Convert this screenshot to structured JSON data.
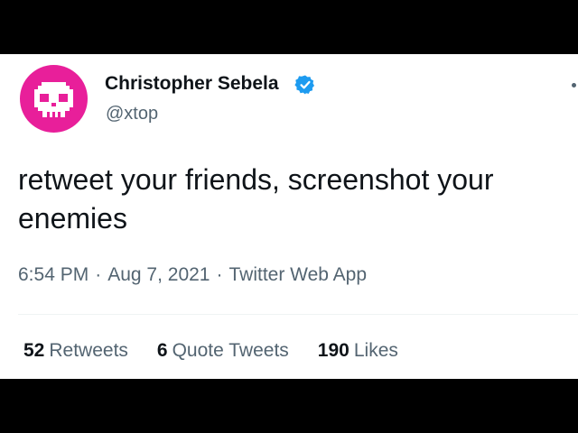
{
  "tweet": {
    "author": {
      "display_name": "Christopher Sebela",
      "handle": "@xtop",
      "verified": true,
      "avatar_icon": "pixel-skull-icon",
      "avatar_color": "#e81f9a"
    },
    "text": "retweet your friends, screenshot your enemies",
    "meta": {
      "time": "6:54 PM",
      "date": "Aug 7, 2021",
      "source": "Twitter Web App",
      "separator": "·"
    },
    "stats": [
      {
        "count": "52",
        "label": "Retweets"
      },
      {
        "count": "6",
        "label": "Quote Tweets"
      },
      {
        "count": "190",
        "label": "Likes"
      }
    ]
  },
  "colors": {
    "verified_blue": "#1d9bf0",
    "secondary_text": "#536471",
    "primary_text": "#0f1419"
  }
}
